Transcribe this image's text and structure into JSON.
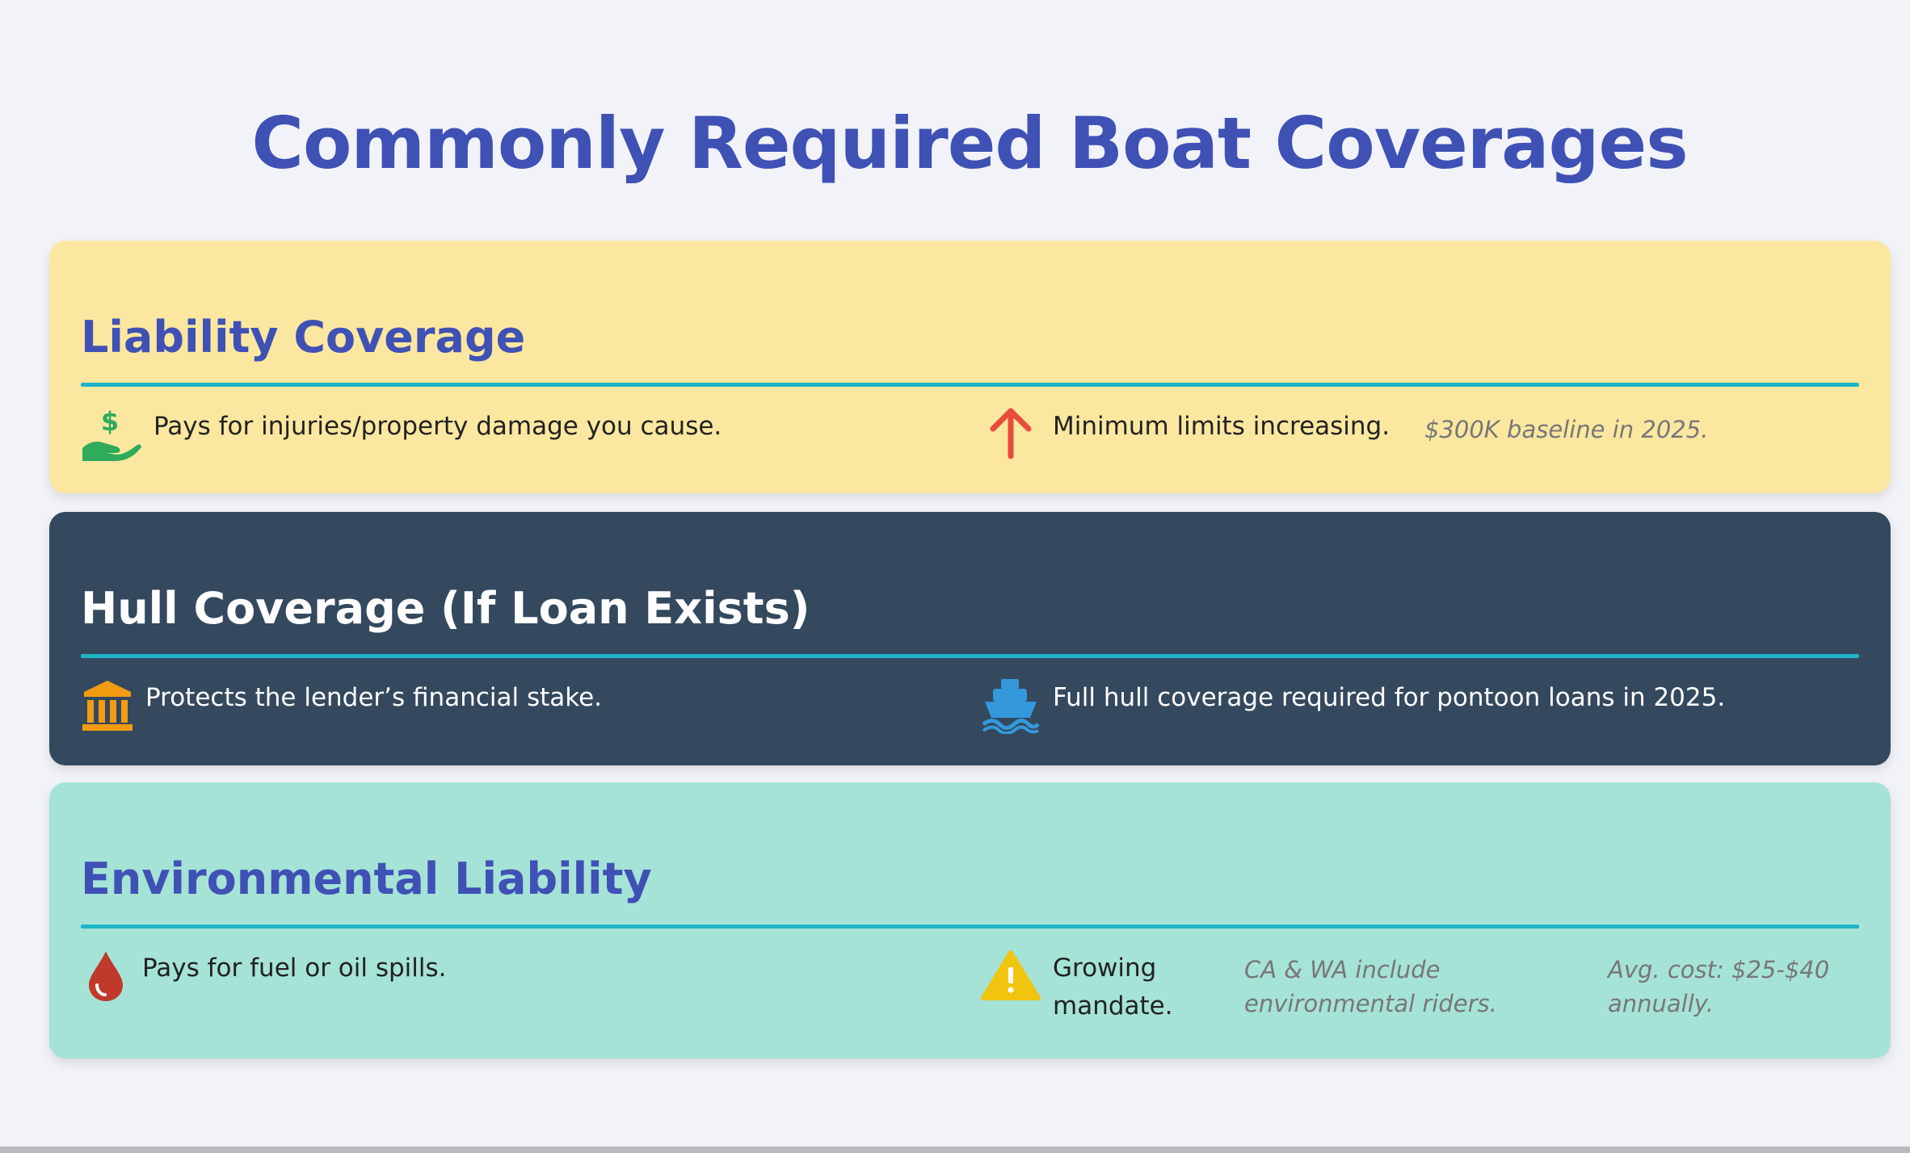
{
  "page": {
    "title": "Commonly Required Boat Coverages"
  },
  "colors": {
    "page_bg": "#f1f3f8",
    "title": "#3f51b5",
    "rule": "#1fb5c9",
    "card1_bg": "#fbe7a0",
    "card2_bg": "#34495e",
    "card3_bg": "#a5e3d6",
    "green_icon": "#2eab5b",
    "red_icon": "#e74c3c",
    "orange_icon": "#f39c12",
    "blue_icon": "#3498db",
    "blood_icon": "#c0392b",
    "warning_icon": "#f1c40f"
  },
  "cards": [
    {
      "title": "Liability Coverage",
      "left_item": {
        "icon": "hand-holding-dollar-icon",
        "text": "Pays for injuries/property damage you cause."
      },
      "right_item": {
        "icon": "arrow-up-icon",
        "text": "Minimum limits increasing."
      },
      "notes": [
        "$300K baseline in 2025."
      ]
    },
    {
      "title": "Hull Coverage (If Loan Exists)",
      "left_item": {
        "icon": "bank-building-icon",
        "text": "Protects the lender’s financial stake."
      },
      "right_item": {
        "icon": "ship-icon",
        "text": "Full hull coverage required for pontoon loans in 2025."
      },
      "notes": []
    },
    {
      "title": "Environmental Liability",
      "left_item": {
        "icon": "oil-drop-icon",
        "text": "Pays for fuel or oil spills."
      },
      "right_item": {
        "icon": "warning-triangle-icon",
        "text_line1": "Growing",
        "text_line2": "mandate."
      },
      "notes": [
        "CA & WA include",
        "environmental riders.",
        "Avg. cost: $25-$40",
        "annually."
      ]
    }
  ]
}
